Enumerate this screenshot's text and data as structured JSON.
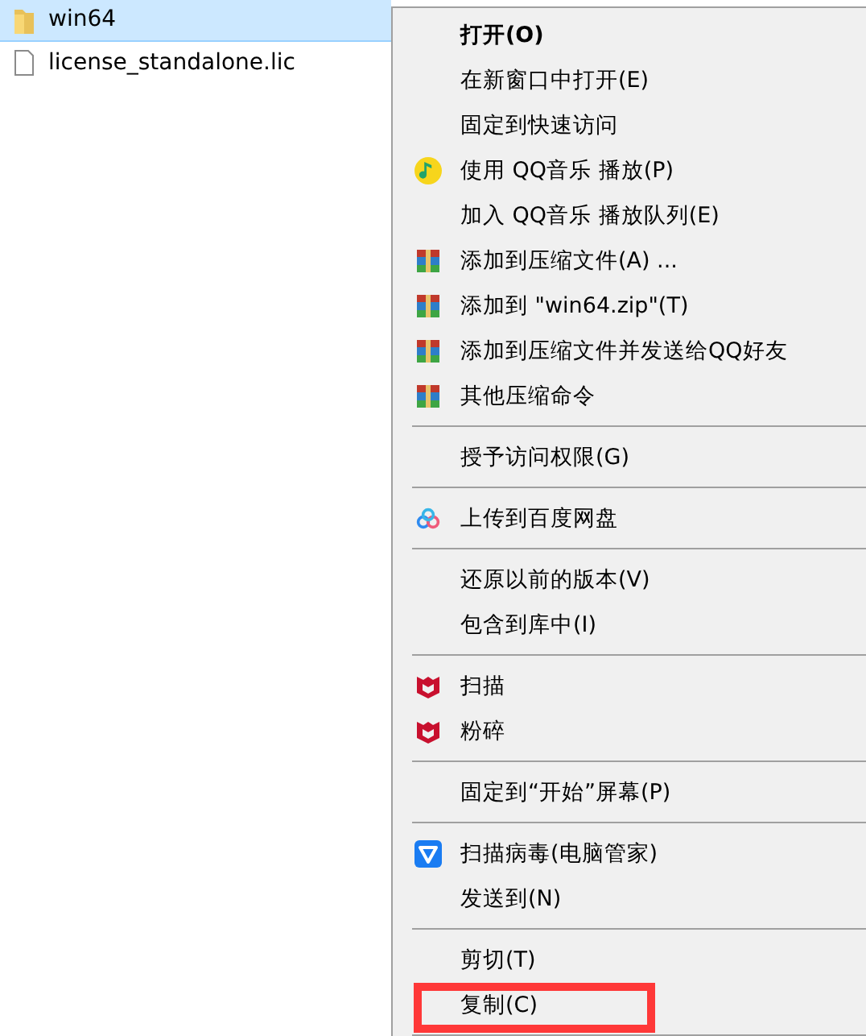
{
  "files": [
    {
      "name": "win64",
      "kind": "folder",
      "selected": true
    },
    {
      "name": "license_standalone.lic",
      "kind": "file",
      "selected": false
    }
  ],
  "context_menu": [
    {
      "kind": "plain",
      "label": "打开(O)",
      "bold": true
    },
    {
      "kind": "plain",
      "label": "在新窗口中打开(E)"
    },
    {
      "kind": "plain",
      "label": "固定到快速访问"
    },
    {
      "kind": "music",
      "label": "使用 QQ音乐 播放(P)"
    },
    {
      "kind": "plain",
      "label": "加入 QQ音乐 播放队列(E)"
    },
    {
      "kind": "archive",
      "label": "添加到压缩文件(A) ..."
    },
    {
      "kind": "archive",
      "label": "添加到 \"win64.zip\"(T)"
    },
    {
      "kind": "archive",
      "label": "添加到压缩文件并发送给QQ好友"
    },
    {
      "kind": "archive",
      "label": "其他压缩命令"
    },
    {
      "kind": "separator"
    },
    {
      "kind": "plain",
      "label": "授予访问权限(G)"
    },
    {
      "kind": "separator"
    },
    {
      "kind": "cloud",
      "label": "上传到百度网盘"
    },
    {
      "kind": "separator"
    },
    {
      "kind": "plain",
      "label": "还原以前的版本(V)"
    },
    {
      "kind": "plain",
      "label": "包含到库中(I)"
    },
    {
      "kind": "separator"
    },
    {
      "kind": "red-shield",
      "label": "扫描"
    },
    {
      "kind": "red-shield",
      "label": "粉碎"
    },
    {
      "kind": "separator"
    },
    {
      "kind": "plain",
      "label": "固定到“开始”屏幕(P)"
    },
    {
      "kind": "separator"
    },
    {
      "kind": "blue-shield",
      "label": "扫描病毒(电脑管家)"
    },
    {
      "kind": "plain",
      "label": "发送到(N)"
    },
    {
      "kind": "separator"
    },
    {
      "kind": "plain",
      "label": "剪切(T)"
    },
    {
      "kind": "plain",
      "label": "复制(C)",
      "highlighted": true
    },
    {
      "kind": "separator"
    }
  ]
}
